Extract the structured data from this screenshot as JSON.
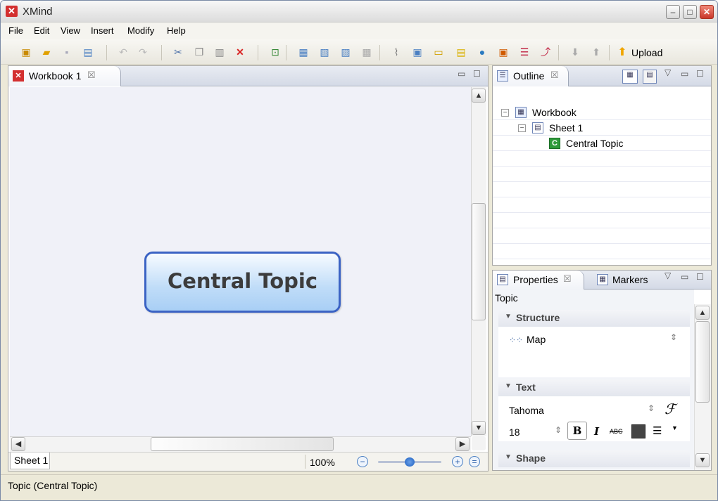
{
  "window": {
    "title": "XMind",
    "app_icon": "xmind-logo-icon"
  },
  "menu": [
    "File",
    "Edit",
    "View",
    "Insert",
    "Modify",
    "Help"
  ],
  "toolbar": {
    "upload_label": "Upload"
  },
  "editor": {
    "tab_label": "Workbook 1",
    "central_topic": "Central Topic",
    "sheet_tab": "Sheet 1",
    "zoom": "100%"
  },
  "outline": {
    "tab_label": "Outline",
    "tree": [
      "Workbook",
      "Sheet 1",
      "Central Topic"
    ]
  },
  "properties": {
    "tab_label": "Properties",
    "markers_tab": "Markers",
    "context": "Topic",
    "structure_header": "Structure",
    "structure_value": "Map",
    "text_header": "Text",
    "font": "Tahoma",
    "size": "18",
    "shape_header": "Shape"
  },
  "status": "Topic (Central Topic)",
  "colors": {
    "topic_border": "#3b63c4",
    "topic_fill": "#bfdcf8",
    "close": "#c9372a"
  }
}
